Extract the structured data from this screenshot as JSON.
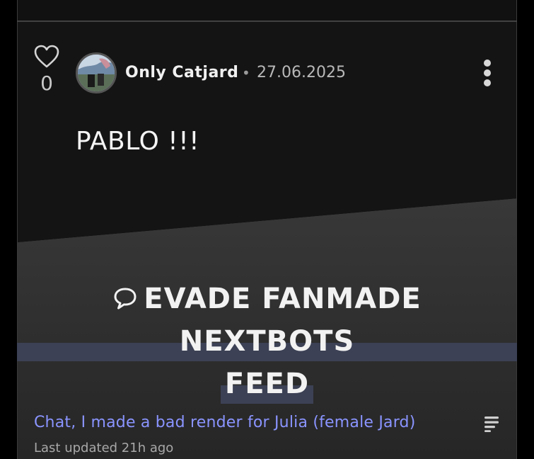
{
  "post": {
    "like_count": "0",
    "author": "Only Catjard",
    "separator": "•",
    "date": "27.06.2025",
    "text": "PABLO !!!"
  },
  "icons": {
    "like": "heart-outline-icon",
    "menu": "vertical-dots-icon",
    "chat": "speech-bubble-icon",
    "thread": "text-lines-icon"
  },
  "feed": {
    "title_line1": "EVADE FANMADE NEXTBOTS",
    "title_line2": "FEED"
  },
  "thread": {
    "title": "Chat, I made a bad render for Julia (female Jard)",
    "updated": "Last updated 21h ago"
  },
  "colors": {
    "accent_link": "#8a94ff",
    "highlight": "#3c4155",
    "card_bg": "#141414",
    "section_bg": "#333333"
  }
}
